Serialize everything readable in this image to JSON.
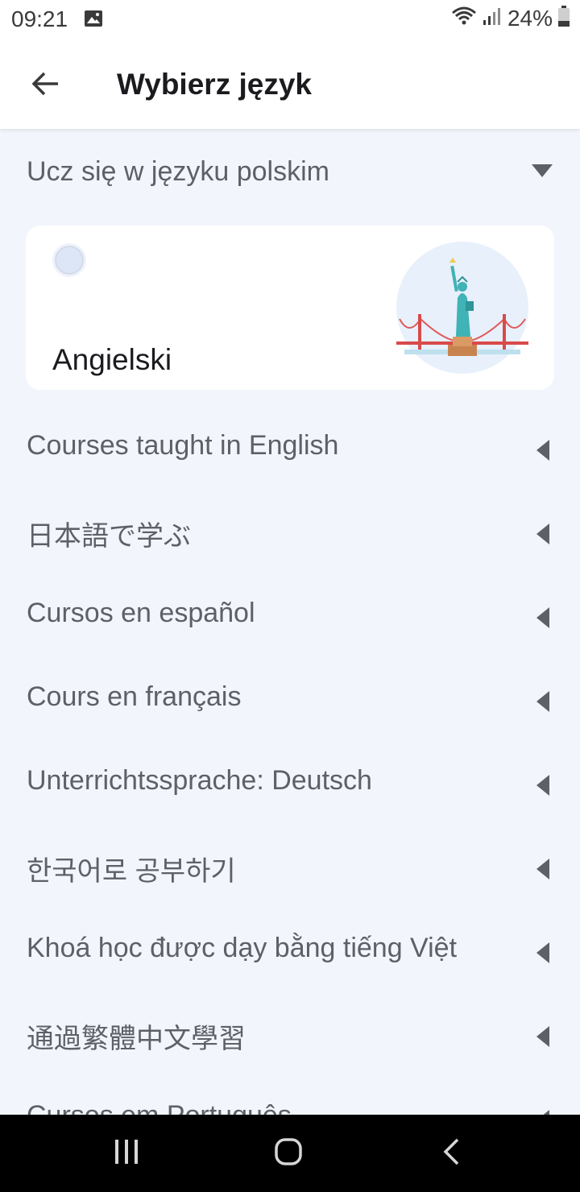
{
  "status_bar": {
    "time": "09:21",
    "battery": "24%",
    "icons": [
      "image-icon",
      "wifi-icon",
      "signal-icon",
      "battery-icon"
    ]
  },
  "app_bar": {
    "title": "Wybierz język",
    "back_icon": "arrow-left-icon"
  },
  "section": {
    "label": "Ucz się w języku polskim",
    "expanded": true
  },
  "card": {
    "label": "Angielski",
    "selected": false,
    "illustration": "statue-of-liberty-bridge"
  },
  "groups": [
    {
      "label": "Courses taught in English"
    },
    {
      "label": "日本語で学ぶ"
    },
    {
      "label": "Cursos en español"
    },
    {
      "label": "Cours en français"
    },
    {
      "label": "Unterrichtssprache: Deutsch"
    },
    {
      "label": "한국어로 공부하기"
    },
    {
      "label": "Khoá học được dạy bằng tiếng Việt"
    },
    {
      "label": "通過繁體中文學習"
    },
    {
      "label": "Cursos em Português"
    }
  ],
  "colors": {
    "background": "#f3f5fc",
    "surface": "#ffffff",
    "text_secondary": "#5d6167",
    "nav_bar": "#000000"
  }
}
